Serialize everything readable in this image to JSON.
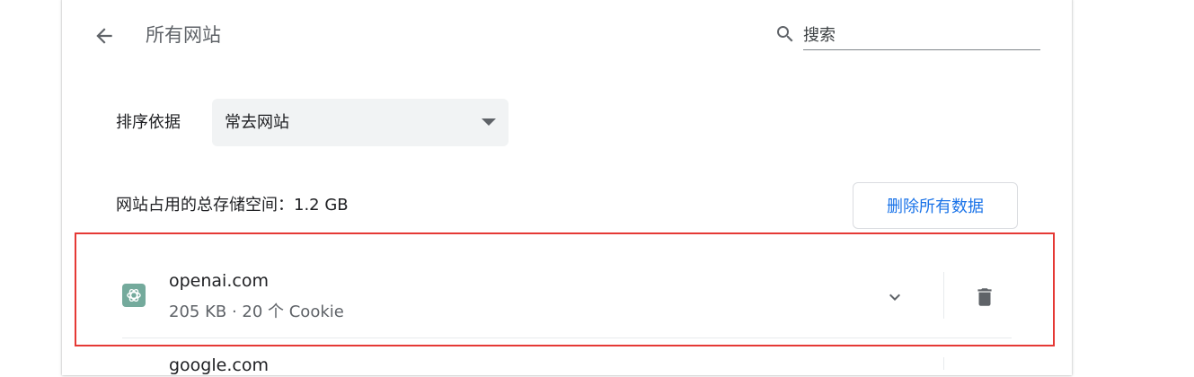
{
  "header": {
    "title": "所有网站",
    "back_icon": "arrow-back-icon",
    "search": {
      "icon": "search-icon",
      "placeholder": "搜索",
      "value": ""
    }
  },
  "sort": {
    "label": "排序依据",
    "selected": "常去网站",
    "caret_icon": "caret-down-icon"
  },
  "storage": {
    "summary": "网站占用的总存储空间：1.2 GB",
    "clear_all_label": "删除所有数据"
  },
  "sites": [
    {
      "name": "openai.com",
      "meta": "205 KB · 20 个 Cookie",
      "favicon_icon": "openai-favicon-icon",
      "favicon_color": "#74aa9c",
      "expand_icon": "chevron-down-icon",
      "delete_icon": "trash-icon"
    },
    {
      "name": "google.com"
    }
  ],
  "colors": {
    "accent": "#1a73e8",
    "highlight": "#e53935",
    "secondary_text": "#5f6368",
    "select_bg": "#f1f3f4"
  }
}
